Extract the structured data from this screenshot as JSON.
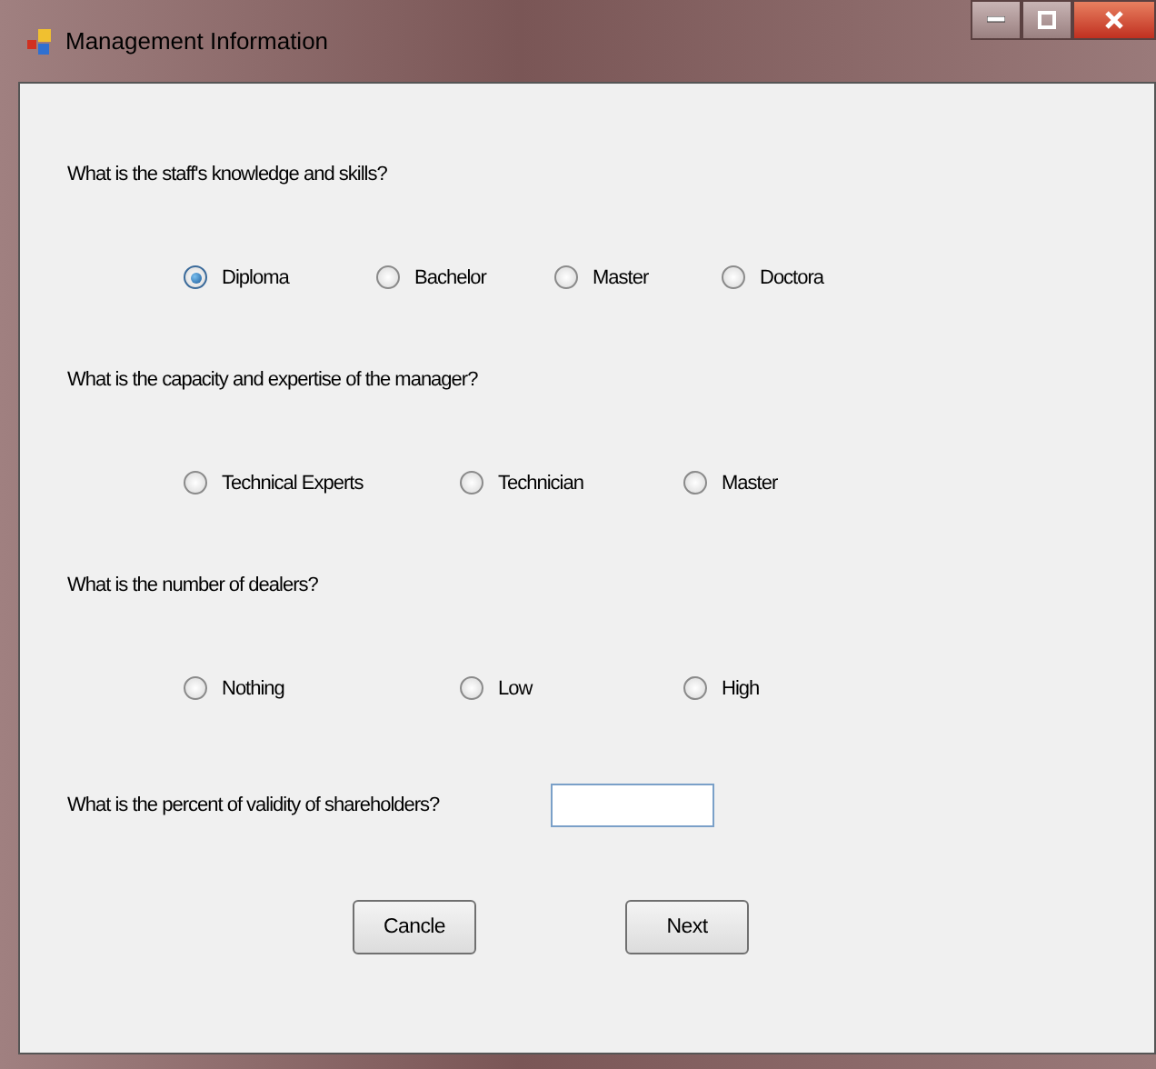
{
  "window": {
    "title": "Management Information"
  },
  "questions": [
    {
      "text": "What is the staff's knowledge and skills?",
      "options": [
        {
          "label": "Diploma",
          "selected": true
        },
        {
          "label": "Bachelor",
          "selected": false
        },
        {
          "label": "Master",
          "selected": false
        },
        {
          "label": "Doctora",
          "selected": false
        }
      ]
    },
    {
      "text": "What is the capacity and expertise of the manager?",
      "options": [
        {
          "label": "Technical Experts",
          "selected": false
        },
        {
          "label": "Technician",
          "selected": false
        },
        {
          "label": "Master",
          "selected": false
        }
      ]
    },
    {
      "text": "What is the number of dealers?",
      "options": [
        {
          "label": "Nothing",
          "selected": false
        },
        {
          "label": "Low",
          "selected": false
        },
        {
          "label": "High",
          "selected": false
        }
      ]
    }
  ],
  "percent_question": {
    "text": "What is the percent of validity of shareholders?"
  },
  "buttons": [
    "Cancle",
    "Next"
  ]
}
